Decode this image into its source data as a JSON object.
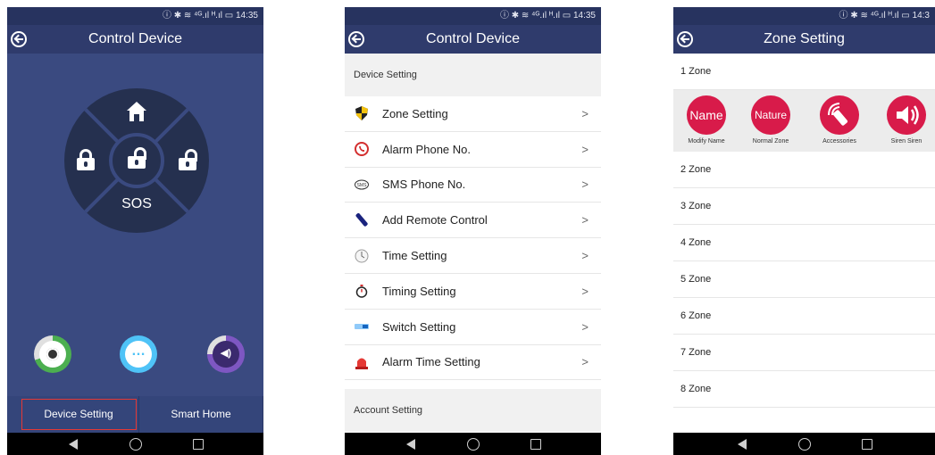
{
  "status": {
    "time_1": "14:35",
    "time_2": "14:35",
    "time_3": "14:3",
    "icons": "ⓘ ✱ ≋ ⁴ᴳ.ıl ᴴ.ıl ▭"
  },
  "panel1": {
    "title": "Control Device",
    "sos_label": "SOS",
    "tabs": {
      "device_setting": "Device Setting",
      "smart_home": "Smart Home"
    }
  },
  "panel2": {
    "title": "Control Device",
    "device_header": "Device Setting",
    "account_header": "Account Setting",
    "items": [
      {
        "label": "Zone Setting",
        "icon": "shield-icon"
      },
      {
        "label": "Alarm Phone No.",
        "icon": "phone-icon"
      },
      {
        "label": "SMS Phone No.",
        "icon": "sms-icon"
      },
      {
        "label": "Add Remote Control",
        "icon": "remote-icon"
      },
      {
        "label": "Time Setting",
        "icon": "clock-icon"
      },
      {
        "label": "Timing Setting",
        "icon": "stopwatch-icon"
      },
      {
        "label": "Switch Setting",
        "icon": "switch-icon"
      },
      {
        "label": "Alarm Time Setting",
        "icon": "siren-icon"
      }
    ],
    "chevron": ">"
  },
  "panel3": {
    "title": "Zone Setting",
    "zones": [
      "1 Zone",
      "2 Zone",
      "3 Zone",
      "4 Zone",
      "5 Zone",
      "6 Zone",
      "7 Zone",
      "8 Zone"
    ],
    "tools": [
      {
        "circle": "Name",
        "label": "Modify Name"
      },
      {
        "circle": "Nature",
        "label": "Normal Zone"
      },
      {
        "circle": "",
        "label": "Accessories"
      },
      {
        "circle": "",
        "label": "Siren Siren"
      }
    ]
  },
  "colors": {
    "accent": "#d81b4a",
    "header": "#2f3b6c",
    "bg_dark": "#3a4a80"
  }
}
